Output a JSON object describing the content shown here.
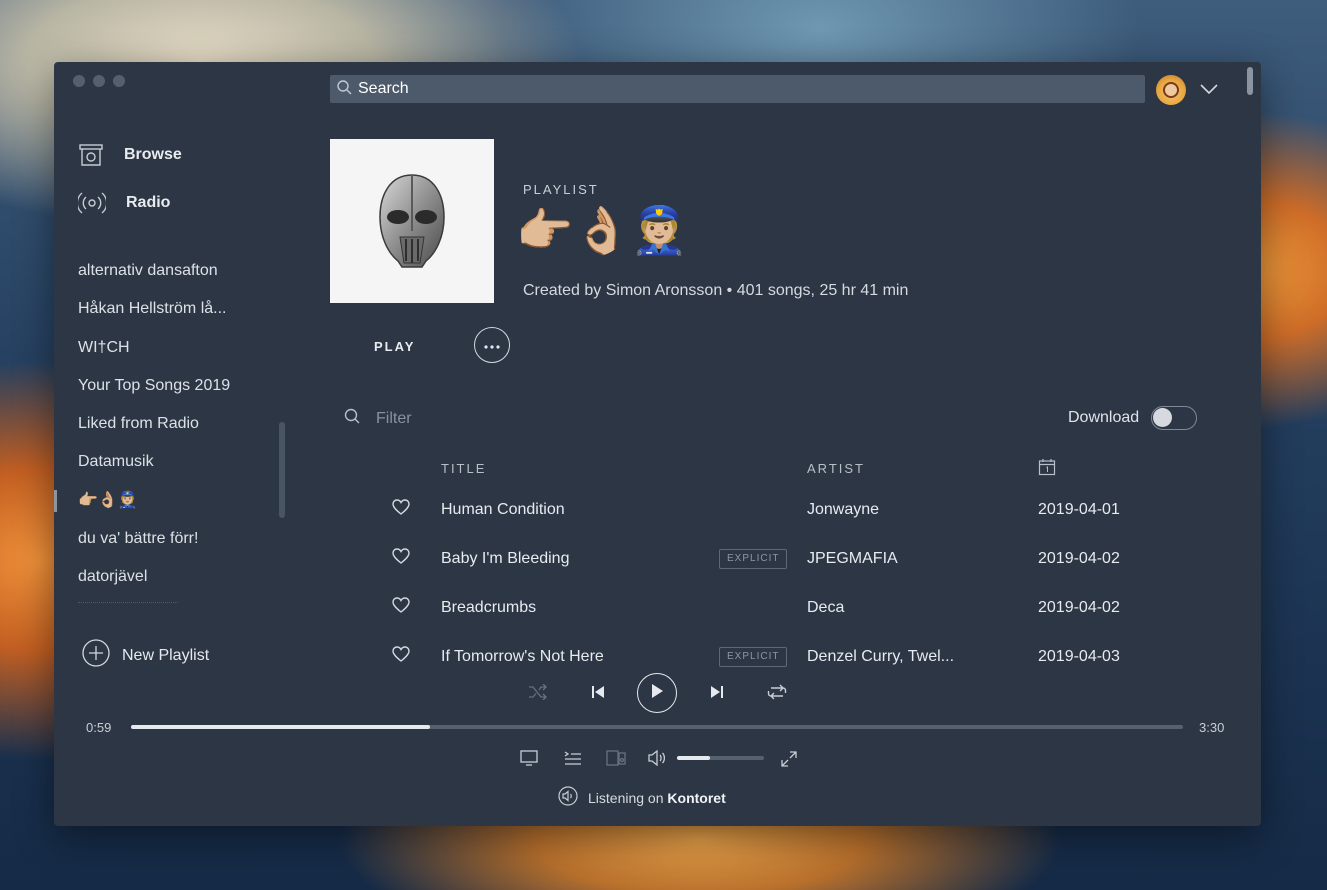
{
  "sidebar": {
    "nav": [
      {
        "label": "Browse",
        "icon": "browse-icon"
      },
      {
        "label": "Radio",
        "icon": "radio-icon"
      }
    ],
    "playlists": [
      "alternativ dansafton",
      "Håkan Hellström lå...",
      "WI†CH",
      "Your Top Songs 2019",
      "Liked from Radio",
      "Datamusik",
      "👉🏼👌🏼👮🏼",
      "du va' bättre förr!",
      "datorjävel"
    ],
    "active_index": 6,
    "new_playlist_label": "New Playlist"
  },
  "search": {
    "placeholder": "Search"
  },
  "playlist": {
    "type_label": "PLAYLIST",
    "title": "👉🏼👌🏼👮🏼",
    "meta": "Created by Simon Aronsson • 401 songs, 25 hr 41 min",
    "play_label": "PLAY"
  },
  "filter": {
    "placeholder": "Filter"
  },
  "download": {
    "label": "Download",
    "enabled": false
  },
  "table": {
    "headers": {
      "title": "TITLE",
      "artist": "ARTIST"
    },
    "tracks": [
      {
        "title": "Human Condition",
        "explicit": "",
        "artist": "Jonwayne",
        "date": "2019-04-01"
      },
      {
        "title": "Baby I'm Bleeding",
        "explicit": "EXPLICIT",
        "artist": "JPEGMAFIA",
        "date": "2019-04-02"
      },
      {
        "title": "Breadcrumbs",
        "explicit": "",
        "artist": "Deca",
        "date": "2019-04-02"
      },
      {
        "title": "If Tomorrow's Not Here",
        "explicit": "EXPLICIT",
        "artist": "Denzel Curry, Twel...",
        "date": "2019-04-03"
      }
    ]
  },
  "player": {
    "elapsed": "0:59",
    "duration": "3:30",
    "progress": 0.284,
    "volume": 0.38,
    "listening_prefix": "Listening on",
    "device": "Kontoret"
  },
  "colors": {
    "window_bg": "#2c3644",
    "search_bg": "#4c5a6b",
    "accent": "#f2d1b0"
  }
}
